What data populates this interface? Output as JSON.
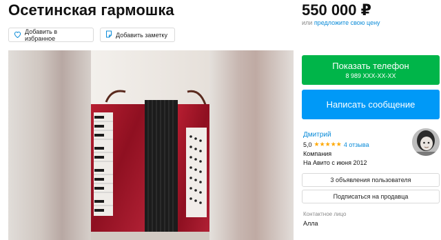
{
  "listing": {
    "title": "Осетинская гармошка",
    "price": "550 000 ₽",
    "price_prefix": "или ",
    "price_offer_link": "предложите свою цену"
  },
  "actions": {
    "favorite": "Добавить в избранное",
    "note": "Добавить заметку"
  },
  "contact_buttons": {
    "show_phone": "Показать телефон",
    "phone_masked": "8 989 XXX-XX-XX",
    "write_message": "Написать сообщение"
  },
  "seller": {
    "name": "Дмитрий",
    "rating": "5,0",
    "stars": "★★★★★",
    "reviews": "4 отзыва",
    "type": "Компания",
    "since": "На Авито с июня 2012",
    "ads_button": "3 объявления пользователя",
    "subscribe_button": "Подписаться на продавца",
    "contact_label": "Контактное лицо",
    "contact_name": "Алла"
  },
  "icons": {
    "favorite": "heart-icon",
    "note": "note-icon"
  },
  "colors": {
    "green": "#00b549",
    "blue": "#0099f7",
    "link": "#0a8bd8",
    "star": "#ffa800",
    "accordion_red": "#a3162a"
  }
}
